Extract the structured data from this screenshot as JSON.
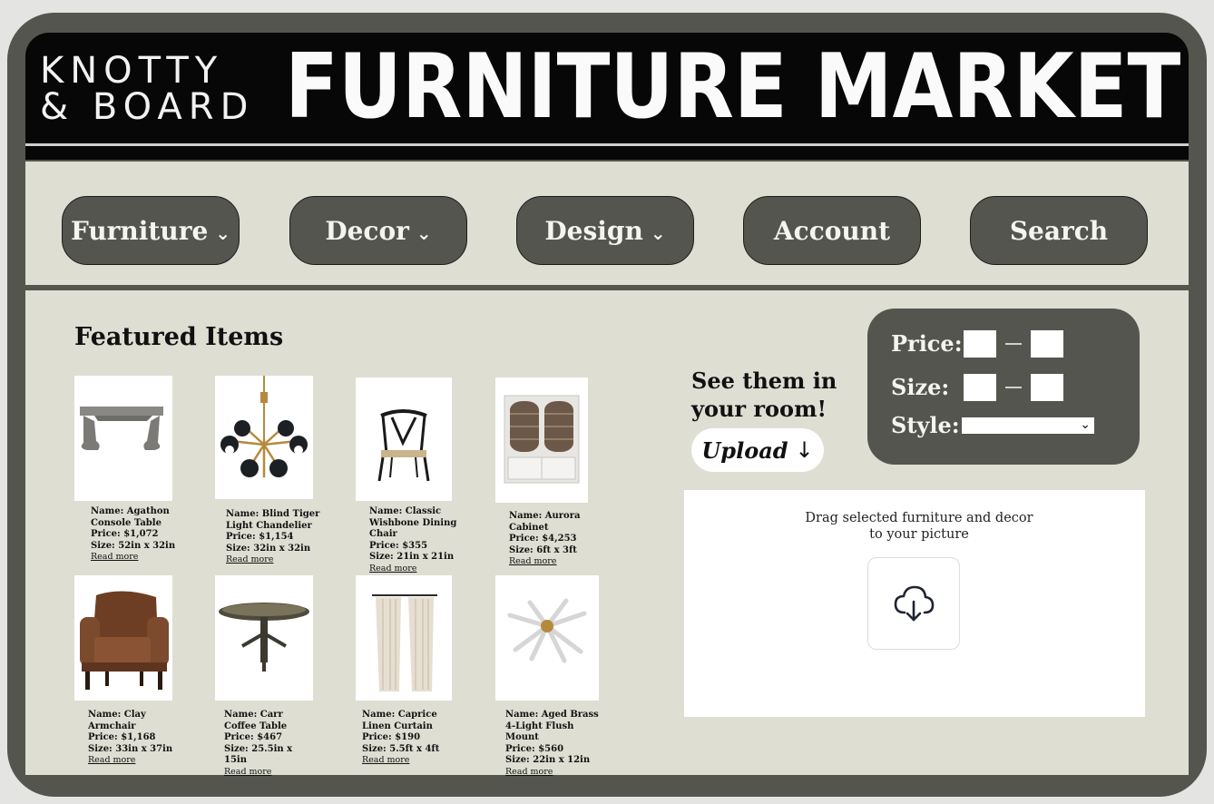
{
  "header": {
    "brand_line1": "KNOTTY",
    "brand_line2": "& BOARD",
    "title": "FURNITURE MARKET"
  },
  "nav": {
    "items": [
      {
        "label": "Furniture",
        "chevron": "⌄"
      },
      {
        "label": "Decor",
        "chevron": "⌄"
      },
      {
        "label": "Design",
        "chevron": "⌄"
      },
      {
        "label": "Account"
      },
      {
        "label": "Search"
      }
    ]
  },
  "featured": {
    "title": "Featured Items",
    "read_more": "Read more",
    "items": [
      {
        "name": "Name: Agathon Console Table",
        "price": "Price: $1,072",
        "size": "Size: 52in x 32in",
        "icon": "console-table-icon"
      },
      {
        "name": "Name: Blind Tiger Light Chandelier",
        "price": "Price: $1,154",
        "size": "Size: 32in x 32in",
        "icon": "chandelier-icon"
      },
      {
        "name": "Name: Classic Wishbone Dining Chair",
        "price": "Price: $355",
        "size": "Size: 21in x 21in",
        "icon": "dining-chair-icon"
      },
      {
        "name": "Name: Aurora Cabinet",
        "price": "Price: $4,253",
        "size": "Size: 6ft x 3ft",
        "icon": "cabinet-icon"
      },
      {
        "name": "Name: Clay Armchair",
        "price": "Price: $1,168",
        "size": "Size: 33in x 37in",
        "icon": "armchair-icon"
      },
      {
        "name": "Name: Carr Coffee Table",
        "price": "Price: $467",
        "size": "Size: 25.5in x 15in",
        "icon": "coffee-table-icon"
      },
      {
        "name": "Name: Caprice Linen Curtain",
        "price": "Price: $190",
        "size": "Size: 5.5ft x 4ft",
        "icon": "curtain-icon"
      },
      {
        "name": "Name: Aged Brass 4-Light Flush Mount",
        "price": "Price: $560",
        "size": "Size: 22in x 12in",
        "icon": "flush-mount-icon"
      }
    ]
  },
  "room": {
    "title_line1": "See them in",
    "title_line2": "your room!",
    "upload_label": "Upload",
    "upload_arrow": "↓"
  },
  "filters": {
    "price_label": "Price:",
    "size_label": "Size:",
    "style_label": "Style:",
    "style_value": "",
    "style_chevron": "⌄"
  },
  "dropzone": {
    "instruction": "Drag selected furniture and decor to your picture",
    "icon": "cloud-download-icon"
  },
  "colors": {
    "frame": "#55554f",
    "panel": "#deded3",
    "banner": "#070707"
  }
}
